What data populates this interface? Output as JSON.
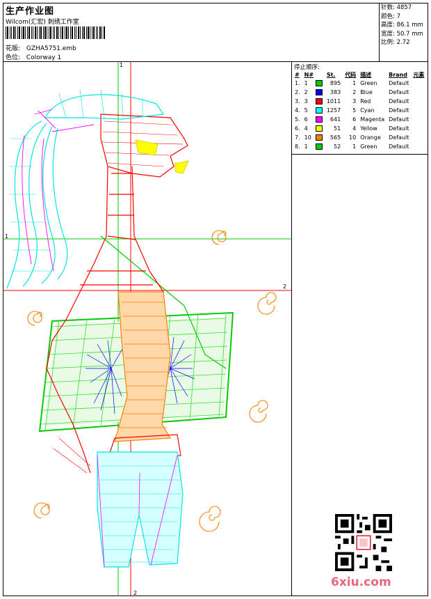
{
  "header": {
    "title": "生产作业图",
    "company": "Wilcom(汇宏) 刺绣工作室",
    "design_label": "花版:",
    "design_value": "GZHA5751.emb",
    "colorway_label": "色位:",
    "colorway_value": "Colorway 1"
  },
  "stats": [
    {
      "label": "针数:",
      "value": "4857"
    },
    {
      "label": "颜色:",
      "value": "7"
    },
    {
      "label": "高度:",
      "value": "86.1 mm"
    },
    {
      "label": "宽度:",
      "value": "50.7 mm"
    },
    {
      "label": "比例:",
      "value": "2.72"
    }
  ],
  "stop_sequence": {
    "title": "停止顺序:",
    "headers": [
      "#",
      "N#",
      "St.",
      "代码",
      "描述",
      "Brand",
      "元素"
    ],
    "rows": [
      {
        "idx": "1.",
        "n": "1",
        "color": "#00cc00",
        "st": "895",
        "code": "1",
        "desc": "Green",
        "brand": "Default"
      },
      {
        "idx": "2.",
        "n": "2",
        "color": "#0000ff",
        "st": "383",
        "code": "2",
        "desc": "Blue",
        "brand": "Default"
      },
      {
        "idx": "3.",
        "n": "3",
        "color": "#ff0000",
        "st": "1011",
        "code": "3",
        "desc": "Red",
        "brand": "Default"
      },
      {
        "idx": "4.",
        "n": "5",
        "color": "#00ffff",
        "st": "1257",
        "code": "5",
        "desc": "Cyan",
        "brand": "Default"
      },
      {
        "idx": "5.",
        "n": "6",
        "color": "#ff00ff",
        "st": "641",
        "code": "6",
        "desc": "Magenta",
        "brand": "Default"
      },
      {
        "idx": "6.",
        "n": "4",
        "color": "#ffff00",
        "st": "51",
        "code": "4",
        "desc": "Yellow",
        "brand": "Default"
      },
      {
        "idx": "7.",
        "n": "10",
        "color": "#ff8000",
        "st": "565",
        "code": "10",
        "desc": "Orange",
        "brand": "Default"
      },
      {
        "idx": "8.",
        "n": "1",
        "color": "#00cc00",
        "st": "52",
        "code": "1",
        "desc": "Green",
        "brand": "Default"
      }
    ]
  },
  "axes": {
    "h1": "1",
    "h2": "2",
    "v1": "1",
    "v2": "2"
  },
  "watermark": "6xiu.com"
}
